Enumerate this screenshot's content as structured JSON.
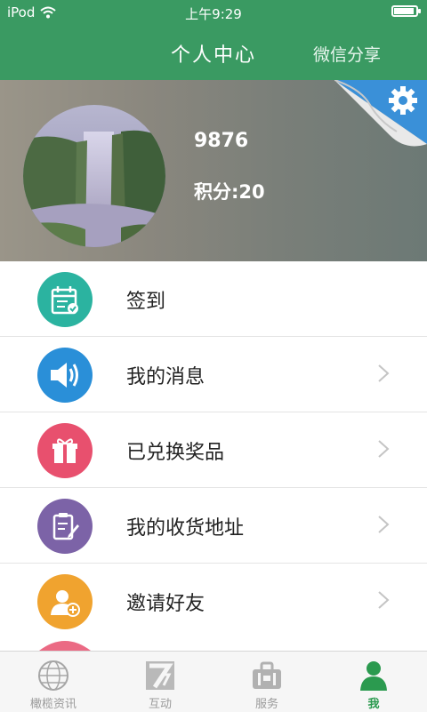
{
  "status_bar": {
    "carrier": "iPod",
    "time": "上午9:29"
  },
  "header": {
    "title": "个人中心",
    "share_label": "微信分享"
  },
  "profile": {
    "username": "9876",
    "points": "积分:20"
  },
  "menu": [
    {
      "label": "签到",
      "icon": "calendar-check-icon",
      "color": "#2bb3a0",
      "chevron": false
    },
    {
      "label": "我的消息",
      "icon": "speaker-icon",
      "color": "#2a8fd8",
      "chevron": true
    },
    {
      "label": "已兑换奖品",
      "icon": "gift-icon",
      "color": "#e8506e",
      "chevron": true
    },
    {
      "label": "我的收货地址",
      "icon": "clipboard-edit-icon",
      "color": "#7c63a7",
      "chevron": true
    },
    {
      "label": "邀请好友",
      "icon": "add-friend-icon",
      "color": "#f0a32f",
      "chevron": true
    }
  ],
  "tabs": [
    {
      "label": "橄榄资讯",
      "icon": "globe-icon",
      "active": false
    },
    {
      "label": "互动",
      "icon": "interact-icon",
      "active": false
    },
    {
      "label": "服务",
      "icon": "briefcase-icon",
      "active": false
    },
    {
      "label": "我",
      "icon": "person-icon",
      "active": true
    }
  ],
  "colors": {
    "header": "#3a9a62",
    "tab_active": "#2b9a4f",
    "settings": "#3a90d8"
  }
}
